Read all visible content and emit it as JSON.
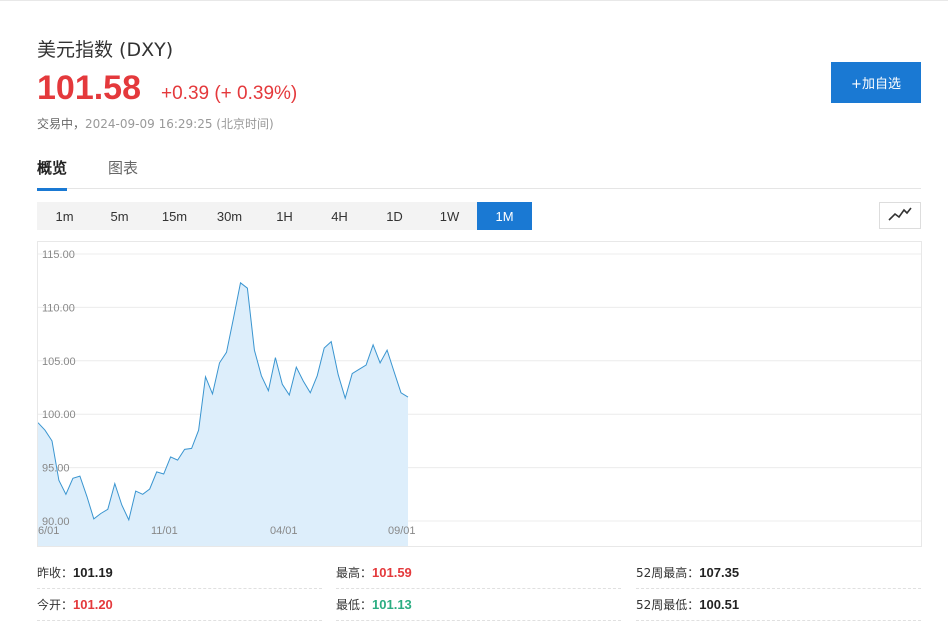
{
  "header": {
    "title": "美元指数 (DXY)",
    "price": "101.58",
    "change": "+0.39 (+ 0.39%)",
    "status_label": "交易中，",
    "timestamp": "2024-09-09 16:29:25 (北京时间)",
    "add_button": "+加自选"
  },
  "tabs": [
    {
      "label": "概览",
      "active": true
    },
    {
      "label": "图表",
      "active": false
    }
  ],
  "periods": [
    {
      "label": "1m",
      "active": false
    },
    {
      "label": "5m",
      "active": false
    },
    {
      "label": "15m",
      "active": false
    },
    {
      "label": "30m",
      "active": false
    },
    {
      "label": "1H",
      "active": false
    },
    {
      "label": "4H",
      "active": false
    },
    {
      "label": "1D",
      "active": false
    },
    {
      "label": "1W",
      "active": false
    },
    {
      "label": "1M",
      "active": true
    }
  ],
  "chart_type_icon": "line-chart-icon",
  "chart_data": {
    "type": "area",
    "ylim": [
      90,
      115
    ],
    "ytick_labels": [
      "115.00",
      "110.00",
      "105.00",
      "100.00",
      "95.00",
      "90.00"
    ],
    "xtick_labels": [
      "6/01",
      "11/01",
      "04/01",
      "09/01"
    ],
    "grid": true,
    "series": [
      {
        "values": [
          99.2,
          98.5,
          97.5,
          93.8,
          92.5,
          94.0,
          94.2,
          92.3,
          90.2,
          90.7,
          91.1,
          93.5,
          91.5,
          90.1,
          92.8,
          92.5,
          93.0,
          94.6,
          94.4,
          96.0,
          95.7,
          96.7,
          96.8,
          98.5,
          103.5,
          101.9,
          104.8,
          105.8,
          109.0,
          112.3,
          111.8,
          106.0,
          103.6,
          102.2,
          105.3,
          102.8,
          101.8,
          104.4,
          103.1,
          102.0,
          103.6,
          106.2,
          106.8,
          103.7,
          101.5,
          103.8,
          104.2,
          104.6,
          106.5,
          104.8,
          106.0,
          104.0,
          102.0,
          101.6
        ]
      }
    ],
    "colors": {
      "line": "#3a95d0",
      "fill": "#ddeefb",
      "grid": "#ececec"
    }
  },
  "stats": [
    {
      "label": "昨收：",
      "value": "101.19",
      "tone": "dark"
    },
    {
      "label": "最高：",
      "value": "101.59",
      "tone": "up"
    },
    {
      "label": "52周最高：",
      "value": "107.35",
      "tone": "dark"
    },
    {
      "label": "今开：",
      "value": "101.20",
      "tone": "up"
    },
    {
      "label": "最低：",
      "value": "101.13",
      "tone": "down"
    },
    {
      "label": "52周最低：",
      "value": "100.51",
      "tone": "dark"
    }
  ],
  "colors": {
    "accent": "#1a79d3",
    "up": "#e4393c",
    "down": "#2bad82"
  }
}
